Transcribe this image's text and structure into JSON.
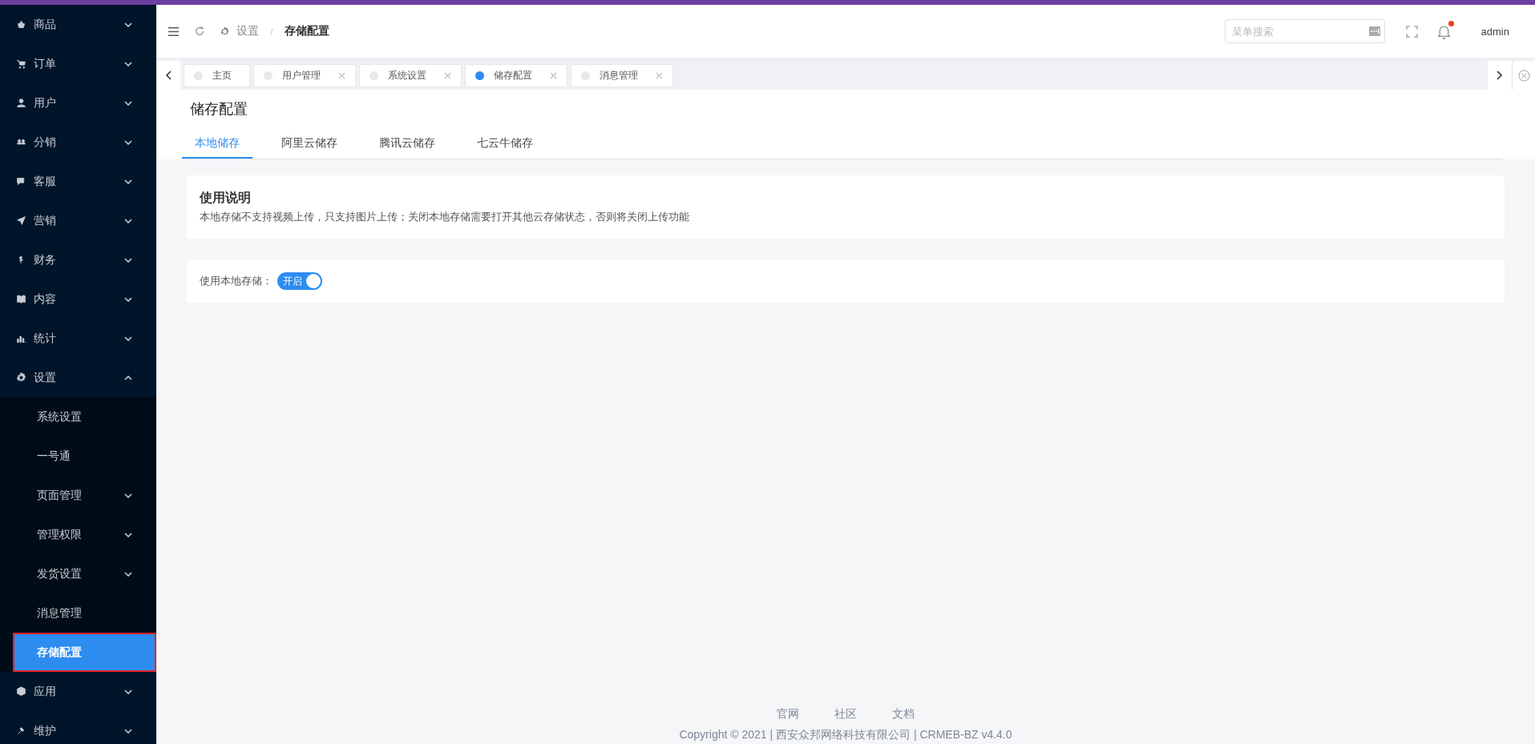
{
  "sidebar": {
    "items": [
      {
        "label": "商品",
        "expanded": false
      },
      {
        "label": "订单",
        "expanded": false
      },
      {
        "label": "用户",
        "expanded": false
      },
      {
        "label": "分销",
        "expanded": false
      },
      {
        "label": "客服",
        "expanded": false
      },
      {
        "label": "营销",
        "expanded": false
      },
      {
        "label": "财务",
        "expanded": false
      },
      {
        "label": "内容",
        "expanded": false
      },
      {
        "label": "统计",
        "expanded": false
      },
      {
        "label": "设置",
        "expanded": true,
        "children": [
          {
            "label": "系统设置",
            "kind": "link",
            "selected": false
          },
          {
            "label": "一号通",
            "kind": "link",
            "selected": false
          },
          {
            "label": "页面管理",
            "kind": "group",
            "selected": false
          },
          {
            "label": "管理权限",
            "kind": "group",
            "selected": false
          },
          {
            "label": "发货设置",
            "kind": "group",
            "selected": false
          },
          {
            "label": "消息管理",
            "kind": "link",
            "selected": false
          },
          {
            "label": "存储配置",
            "kind": "link",
            "selected": true
          }
        ]
      },
      {
        "label": "应用",
        "expanded": false
      },
      {
        "label": "维护",
        "expanded": false
      }
    ]
  },
  "header": {
    "breadcrumb": [
      "设置",
      "存储配置"
    ],
    "breadcrumb_separator": "/",
    "search": {
      "placeholder": "菜单搜索"
    },
    "notification_dot": true,
    "user": "admin"
  },
  "page_tabs": [
    {
      "label": "主页",
      "selected": false,
      "closable": false
    },
    {
      "label": "用户管理",
      "selected": false,
      "closable": true
    },
    {
      "label": "系统设置",
      "selected": false,
      "closable": true
    },
    {
      "label": "储存配置",
      "selected": true,
      "closable": true
    },
    {
      "label": "消息管理",
      "selected": false,
      "closable": true
    }
  ],
  "page": {
    "title": "储存配置",
    "tabs": [
      {
        "label": "本地储存",
        "selected": true
      },
      {
        "label": "阿里云储存",
        "selected": false
      },
      {
        "label": "腾讯云储存",
        "selected": false
      },
      {
        "label": "七云牛储存",
        "selected": false
      }
    ],
    "notice": {
      "title": "使用说明",
      "text": "本地存储不支持视频上传，只支持图片上传；关闭本地存储需要打开其他云存储状态，否则将关闭上传功能"
    },
    "setting": {
      "label": "使用本地存储：",
      "on": true,
      "toggle_text": "开启"
    }
  },
  "footer": {
    "links": [
      "官网",
      "社区",
      "文档"
    ],
    "copyright": "Copyright © 2021 | 西安众邦网络科技有限公司 | CRMEB-BZ v4.4.0"
  }
}
